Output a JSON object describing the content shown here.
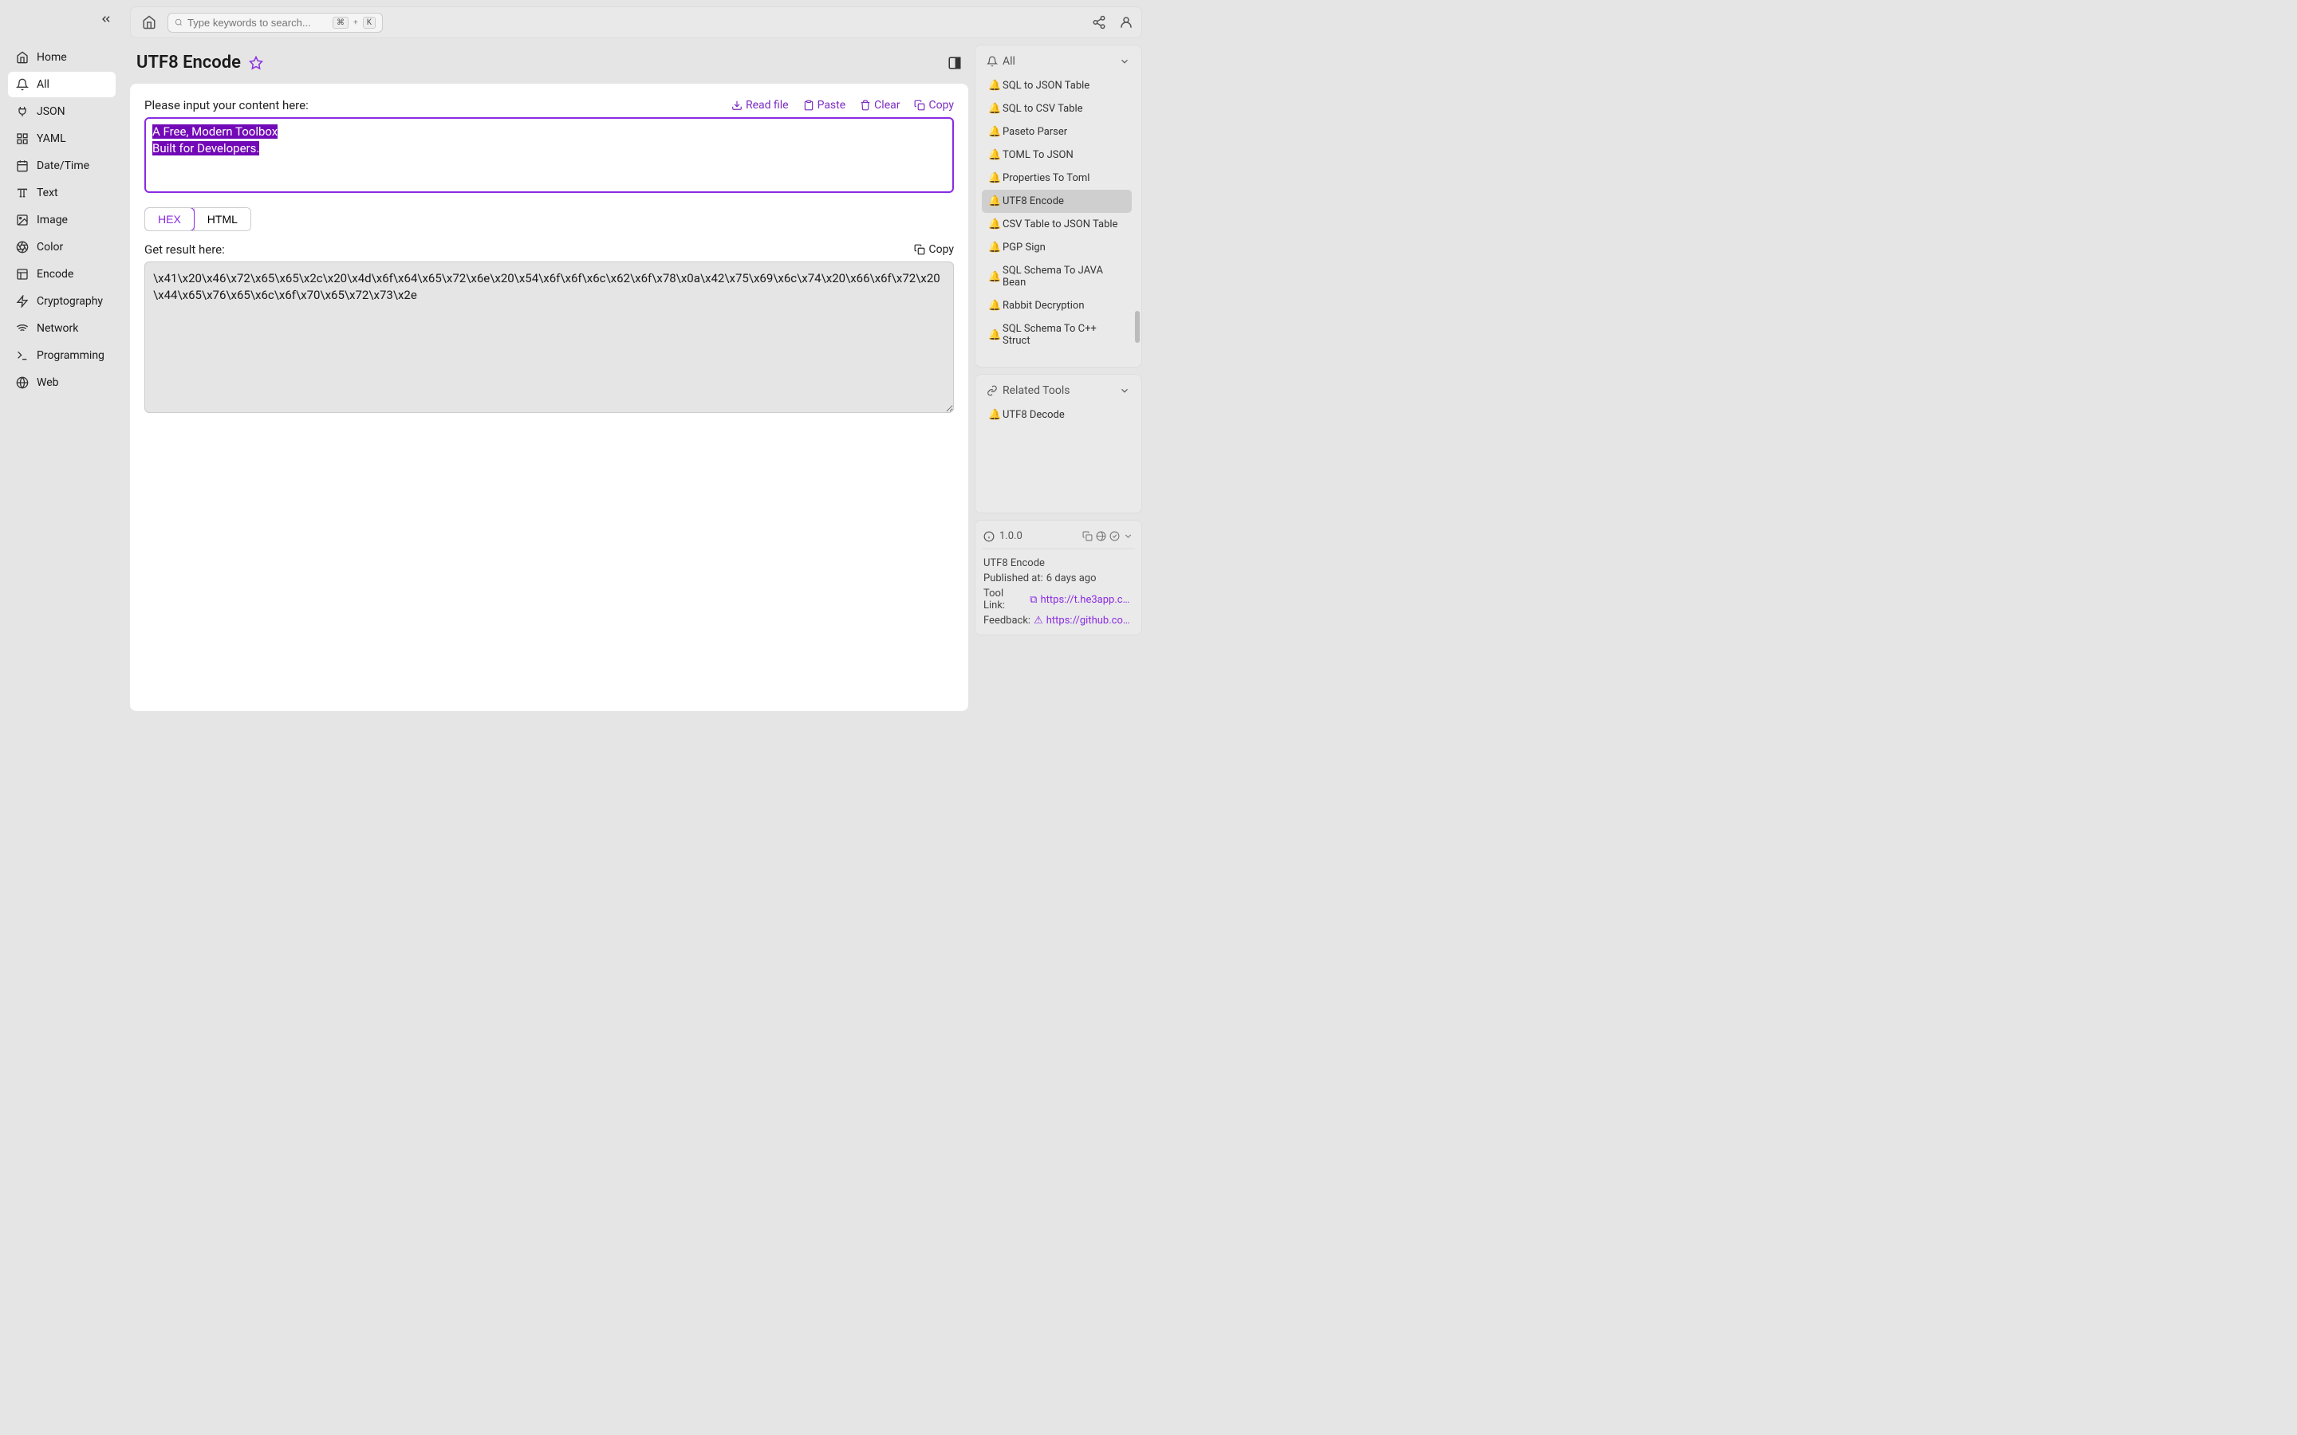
{
  "sidebar": {
    "items": [
      {
        "label": "Home"
      },
      {
        "label": "All"
      },
      {
        "label": "JSON"
      },
      {
        "label": "YAML"
      },
      {
        "label": "Date/Time"
      },
      {
        "label": "Text"
      },
      {
        "label": "Image"
      },
      {
        "label": "Color"
      },
      {
        "label": "Encode"
      },
      {
        "label": "Cryptography"
      },
      {
        "label": "Network"
      },
      {
        "label": "Programming"
      },
      {
        "label": "Web"
      }
    ]
  },
  "search": {
    "placeholder": "Type keywords to search...",
    "kbd1": "⌘",
    "kbd_plus": "+",
    "kbd2": "K"
  },
  "page": {
    "title": "UTF8 Encode"
  },
  "input": {
    "label": "Please input your content here:",
    "line1": "A Free, Modern Toolbox",
    "line2": "Built for Developers.",
    "actions": {
      "read": "Read file",
      "paste": "Paste",
      "clear": "Clear",
      "copy": "Copy"
    }
  },
  "toggle": {
    "hex": "HEX",
    "html": "HTML"
  },
  "output": {
    "label": "Get result here:",
    "copy": "Copy",
    "value": "\\x41\\x20\\x46\\x72\\x65\\x65\\x2c\\x20\\x4d\\x6f\\x64\\x65\\x72\\x6e\\x20\\x54\\x6f\\x6f\\x6c\\x62\\x6f\\x78\\x0a\\x42\\x75\\x69\\x6c\\x74\\x20\\x66\\x6f\\x72\\x20\\x44\\x65\\x76\\x65\\x6c\\x6f\\x70\\x65\\x72\\x73\\x2e"
  },
  "rail": {
    "all_label": "All",
    "tools": [
      "SQL to JSON Table",
      "SQL to CSV Table",
      "Paseto Parser",
      "TOML To JSON",
      "Properties To Toml",
      "UTF8 Encode",
      "CSV Table to JSON Table",
      "PGP Sign",
      "SQL Schema To JAVA Bean",
      "Rabbit Decryption",
      "SQL Schema To C++ Struct"
    ],
    "related_label": "Related Tools",
    "related": [
      "UTF8 Decode"
    ]
  },
  "info": {
    "version": "1.0.0",
    "name": "UTF8 Encode",
    "published_label": "Published at:",
    "published_value": "6 days ago",
    "toollink_label": "Tool Link:",
    "toollink_value": "https://t.he3app.co…",
    "feedback_label": "Feedback:",
    "feedback_value": "https://github.com/…"
  }
}
